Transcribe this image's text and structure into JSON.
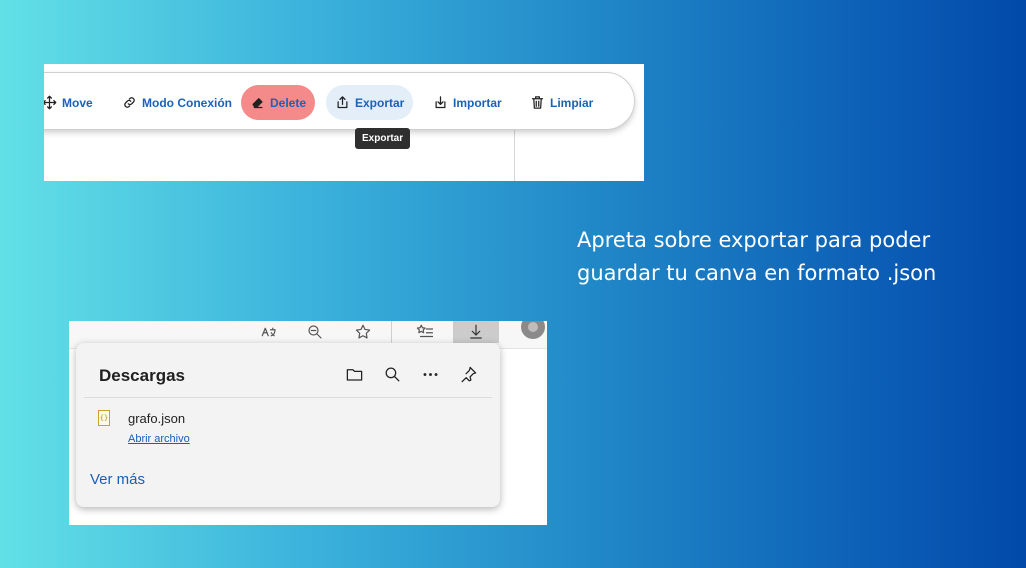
{
  "toolbar": {
    "items": [
      {
        "label": "Move",
        "icon": "move-icon"
      },
      {
        "label": "Modo Conexión",
        "icon": "link-icon"
      },
      {
        "label": "Delete",
        "icon": "eraser-icon"
      },
      {
        "label": "Exportar",
        "icon": "export-icon"
      },
      {
        "label": "Importar",
        "icon": "import-icon"
      },
      {
        "label": "Limpiar",
        "icon": "trash-icon"
      }
    ],
    "tooltip": "Exportar",
    "colors": {
      "accent": "#1b62b8",
      "delete_bg": "#f58a8a",
      "export_bg": "#e3eef9"
    }
  },
  "caption": {
    "line1": "Apreta sobre exportar para poder",
    "line2": "guardar tu canva en formato .json"
  },
  "browser_bar": {
    "icons": [
      "read-aloud-icon",
      "zoom-out-icon",
      "favorite-star-icon",
      "favorites-list-icon",
      "downloads-icon",
      "profile-avatar"
    ]
  },
  "downloads": {
    "title": "Descargas",
    "header_icons": [
      "folder-icon",
      "search-icon",
      "more-icon",
      "pin-icon"
    ],
    "files": [
      {
        "name": "grafo.json",
        "action": "Abrir archivo",
        "icon": "json-file-icon"
      }
    ],
    "see_more": "Ver más"
  }
}
